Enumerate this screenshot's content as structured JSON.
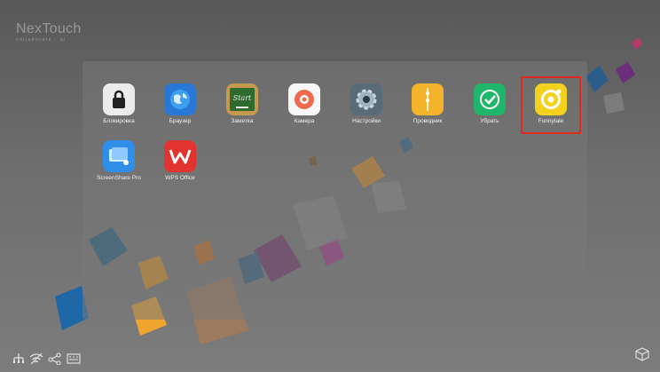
{
  "brand": {
    "name": "NexTouch",
    "tagline": "collaborate · ai"
  },
  "apps_row1": [
    {
      "label": "Блокировка",
      "icon": "lock-icon",
      "bg": "#ececec"
    },
    {
      "label": "Браузер",
      "icon": "globe-icon",
      "bg": "#2a78d6"
    },
    {
      "label": "Заметка",
      "icon": "chalkboard-icon",
      "bg": "#3f7f38"
    },
    {
      "label": "Камера",
      "icon": "camera-icon",
      "bg": "#f7f7f7"
    },
    {
      "label": "Настройки",
      "icon": "gear-icon",
      "bg": "#5a6b78"
    },
    {
      "label": "Проводник",
      "icon": "folder-icon",
      "bg": "#f3b42b"
    },
    {
      "label": "Убрать",
      "icon": "checkmark-icon",
      "bg": "#1fb56a"
    },
    {
      "label": "Funnytale",
      "icon": "funnytale-icon",
      "bg": "#f2d21d"
    }
  ],
  "apps_row2": [
    {
      "label": "ScreenShare Pro",
      "icon": "screenshare-icon",
      "bg": "#2f8fe8"
    },
    {
      "label": "WPS Office",
      "icon": "wps-icon",
      "bg": "#e2342f"
    }
  ],
  "tray": [
    {
      "icon": "network-icon",
      "glyph": "⚇"
    },
    {
      "icon": "wifi-off-icon",
      "glyph": "◡"
    },
    {
      "icon": "share-icon",
      "glyph": "≺"
    },
    {
      "icon": "keyboard-icon",
      "glyph": "▭"
    }
  ]
}
